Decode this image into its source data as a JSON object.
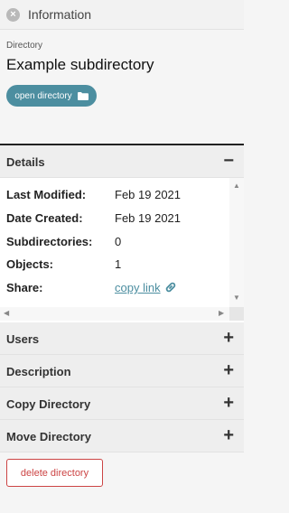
{
  "topbar": {
    "title": "Information",
    "close_icon": "×"
  },
  "header": {
    "kind_label": "Directory",
    "name": "Example subdirectory",
    "open_button_label": "open directory"
  },
  "sections": {
    "details": {
      "title": "Details",
      "toggle": "−",
      "expanded": true
    },
    "users": {
      "title": "Users",
      "toggle": "+"
    },
    "description": {
      "title": "Description",
      "toggle": "+"
    },
    "copy_directory": {
      "title": "Copy Directory",
      "toggle": "+"
    },
    "move_directory": {
      "title": "Move Directory",
      "toggle": "+"
    }
  },
  "details": {
    "rows": [
      {
        "label": "Last Modified:",
        "value": "Feb 19 2021"
      },
      {
        "label": "Date Created:",
        "value": "Feb 19 2021"
      },
      {
        "label": "Subdirectories:",
        "value": "0"
      },
      {
        "label": "Objects:",
        "value": "1"
      },
      {
        "label": "Share:",
        "value": "copy link"
      }
    ]
  },
  "delete_button_label": "delete directory",
  "colors": {
    "accent": "#4c8ea0",
    "danger": "#cc4444"
  },
  "icons": {
    "close": "close-icon",
    "folder": "folder-icon",
    "link": "link-icon"
  }
}
